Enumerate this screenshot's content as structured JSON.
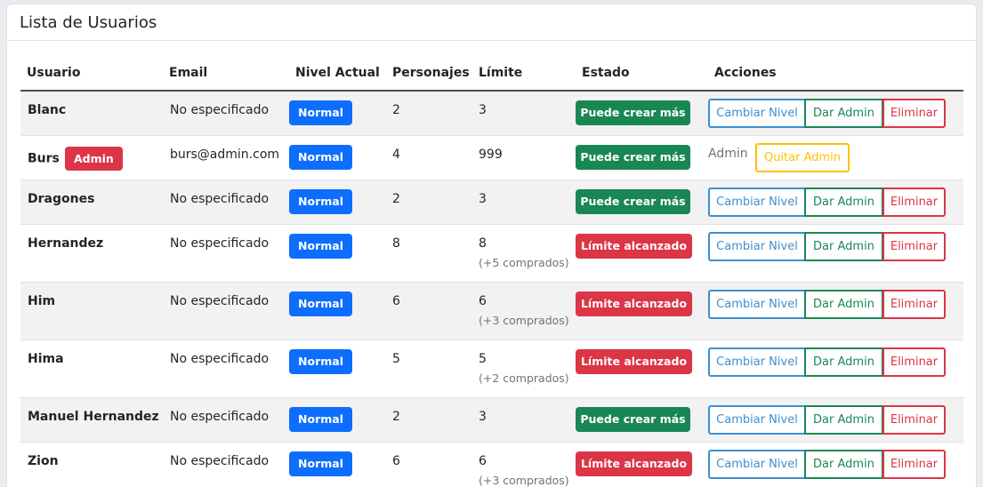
{
  "card": {
    "title": "Lista de Usuarios"
  },
  "table": {
    "headers": {
      "user": "Usuario",
      "email": "Email",
      "level": "Nivel Actual",
      "chars": "Personajes",
      "limit": "Límite",
      "state": "Estado",
      "actions": "Acciones"
    },
    "action_labels": {
      "change_level": "Cambiar Nivel",
      "make_admin": "Dar Admin",
      "delete": "Eliminar",
      "remove_admin": "Quitar Admin",
      "admin_text": "Admin"
    },
    "rows": [
      {
        "user": "Blanc",
        "email": "No especificado",
        "level": "Normal",
        "chars": "2",
        "limit": "3",
        "extra": "",
        "state": "Puede crear más",
        "admin_badge": ""
      },
      {
        "user": "Burs",
        "email": "burs@admin.com",
        "level": "Normal",
        "chars": "4",
        "limit": "999",
        "extra": "",
        "state": "Puede crear más",
        "admin_badge": "Admin"
      },
      {
        "user": "Dragones",
        "email": "No especificado",
        "level": "Normal",
        "chars": "2",
        "limit": "3",
        "extra": "",
        "state": "Puede crear más",
        "admin_badge": ""
      },
      {
        "user": "Hernandez",
        "email": "No especificado",
        "level": "Normal",
        "chars": "8",
        "limit": "8",
        "extra": "(+5 comprados)",
        "state": "Límite alcanzado",
        "admin_badge": ""
      },
      {
        "user": "Him",
        "email": "No especificado",
        "level": "Normal",
        "chars": "6",
        "limit": "6",
        "extra": "(+3 comprados)",
        "state": "Límite alcanzado",
        "admin_badge": ""
      },
      {
        "user": "Hima",
        "email": "No especificado",
        "level": "Normal",
        "chars": "5",
        "limit": "5",
        "extra": "(+2 comprados)",
        "state": "Límite alcanzado",
        "admin_badge": ""
      },
      {
        "user": "Manuel Hernandez",
        "email": "No especificado",
        "level": "Normal",
        "chars": "2",
        "limit": "3",
        "extra": "",
        "state": "Puede crear más",
        "admin_badge": ""
      },
      {
        "user": "Zion",
        "email": "No especificado",
        "level": "Normal",
        "chars": "6",
        "limit": "6",
        "extra": "(+3 comprados)",
        "state": "Límite alcanzado",
        "admin_badge": ""
      }
    ]
  },
  "colors": {
    "primary": "#0d6efd",
    "success": "#198754",
    "danger": "#dc3545",
    "warning": "#ffc107",
    "info_outline": "#3d8fd0"
  }
}
